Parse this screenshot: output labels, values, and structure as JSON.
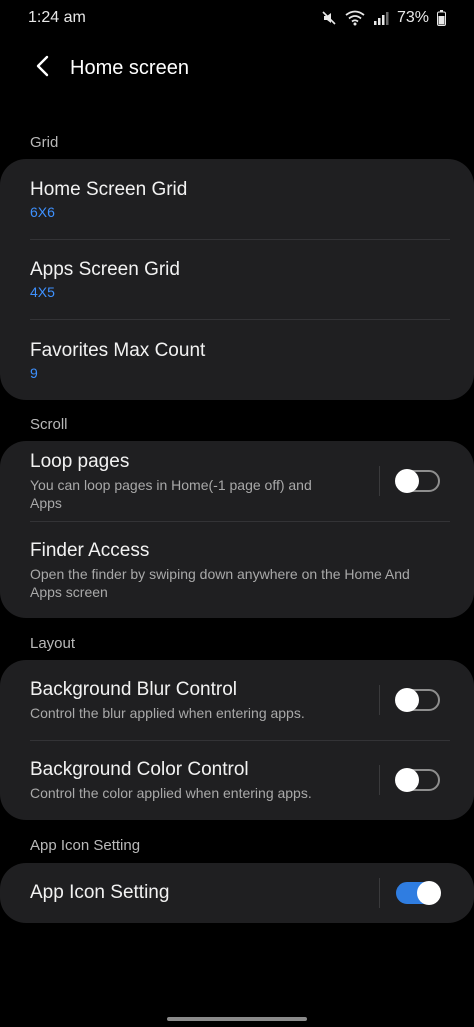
{
  "status_bar": {
    "time": "1:24 am",
    "battery": "73%"
  },
  "header": {
    "title": "Home screen"
  },
  "sections": {
    "grid": {
      "label": "Grid",
      "items": [
        {
          "title": "Home Screen Grid",
          "value": "6X6"
        },
        {
          "title": "Apps Screen Grid",
          "value": "4X5"
        },
        {
          "title": "Favorites Max Count",
          "value": "9"
        }
      ]
    },
    "scroll": {
      "label": "Scroll",
      "items": [
        {
          "title": "Loop pages",
          "subtitle": "You can loop pages in Home(-1 page off) and Apps",
          "toggle": false
        },
        {
          "title": "Finder Access",
          "subtitle": "Open the finder by swiping down anywhere on the Home And Apps screen"
        }
      ]
    },
    "layout": {
      "label": "Layout",
      "items": [
        {
          "title": "Background Blur Control",
          "subtitle": "Control the blur applied when entering apps.",
          "toggle": false
        },
        {
          "title": "Background Color Control",
          "subtitle": "Control the color applied when entering apps.",
          "toggle": false
        }
      ]
    },
    "app_icon": {
      "label": "App Icon Setting",
      "items": [
        {
          "title": "App Icon Setting",
          "toggle": true
        }
      ]
    }
  },
  "colors": {
    "accent": "#3e91ff",
    "toggle_on": "#2f7de1",
    "card": "#1f1f21",
    "background": "#000000"
  },
  "icons": [
    "mute-icon",
    "wifi-icon",
    "signal-icon",
    "battery-icon",
    "back-arrow-icon"
  ]
}
